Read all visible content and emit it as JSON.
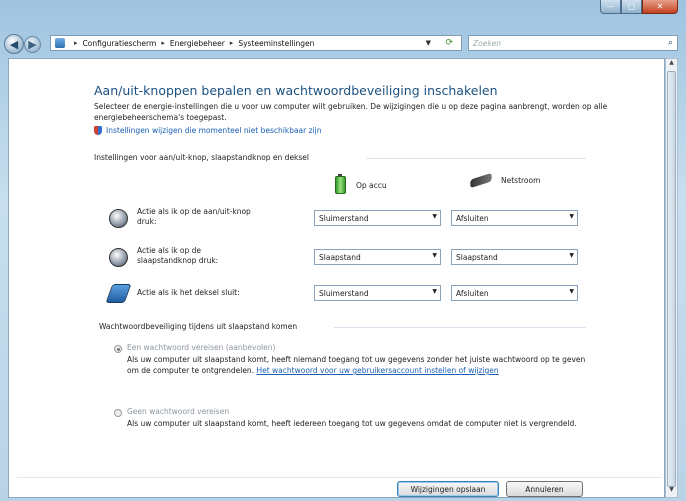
{
  "window": {
    "min_label": "—",
    "max_label": "▢",
    "close_label": "✕"
  },
  "breadcrumb": {
    "items": [
      "Configuratiescherm",
      "Energiebeheer",
      "Systeeminstellingen"
    ],
    "separator": "▸"
  },
  "search": {
    "placeholder": "Zoeken"
  },
  "page": {
    "title": "Aan/uit-knoppen bepalen en wachtwoordbeveiliging inschakelen",
    "intro": "Selecteer de energie-instellingen die u voor uw computer wilt gebruiken. De wijzigingen die u op deze pagina aanbrengt, worden op alle energiebeheerschema's toegepast.",
    "link_unavailable": "Instellingen wijzigen die momenteel niet beschikbaar zijn"
  },
  "buttons_section": {
    "header": "Instellingen voor aan/uit-knop, slaapstandknop en deksel",
    "col_battery": "Op accu",
    "col_ac": "Netstroom",
    "rows": [
      {
        "label": "Actie als ik op de aan/uit-knop druk:",
        "battery": "Sluimerstand",
        "ac": "Afsluiten"
      },
      {
        "label": "Actie als ik op de slaapstandknop druk:",
        "battery": "Slaapstand",
        "ac": "Slaapstand"
      },
      {
        "label": "Actie als ik het deksel sluit:",
        "battery": "Sluimerstand",
        "ac": "Afsluiten"
      }
    ]
  },
  "password_section": {
    "header": "Wachtwoordbeveiliging tijdens uit slaapstand komen",
    "option1": {
      "label": "Een wachtwoord vereisen (aanbevolen)",
      "text": "Als uw computer uit slaapstand komt, heeft niemand toegang tot uw gegevens zonder het juiste wachtwoord op te geven om de computer te ontgrendelen.",
      "link": "Het wachtwoord voor uw gebruikersaccount instellen of wijzigen"
    },
    "option2": {
      "label": "Geen wachtwoord vereisen",
      "text": "Als uw computer uit slaapstand komt, heeft iedereen toegang tot uw gegevens omdat de computer niet is vergrendeld."
    }
  },
  "actions": {
    "save": "Wijzigingen opslaan",
    "cancel": "Annuleren"
  }
}
